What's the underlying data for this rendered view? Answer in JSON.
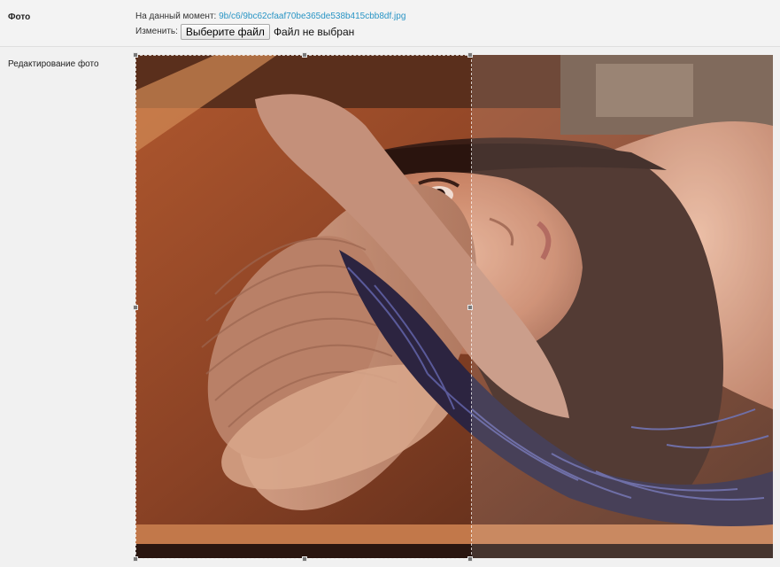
{
  "photo_row": {
    "label": "Фото",
    "current_prefix": "На данный момент:",
    "current_file": "9b/c6/9bc62cfaaf70be365de538b415cbb8df.jpg",
    "change_label": "Изменить:",
    "choose_button": "Выберите файл",
    "no_file_text": "Файл не выбран"
  },
  "edit_row": {
    "label": "Редактирование фото"
  },
  "colors": {
    "link": "#2a95c5",
    "background": "#f1f1f1"
  }
}
